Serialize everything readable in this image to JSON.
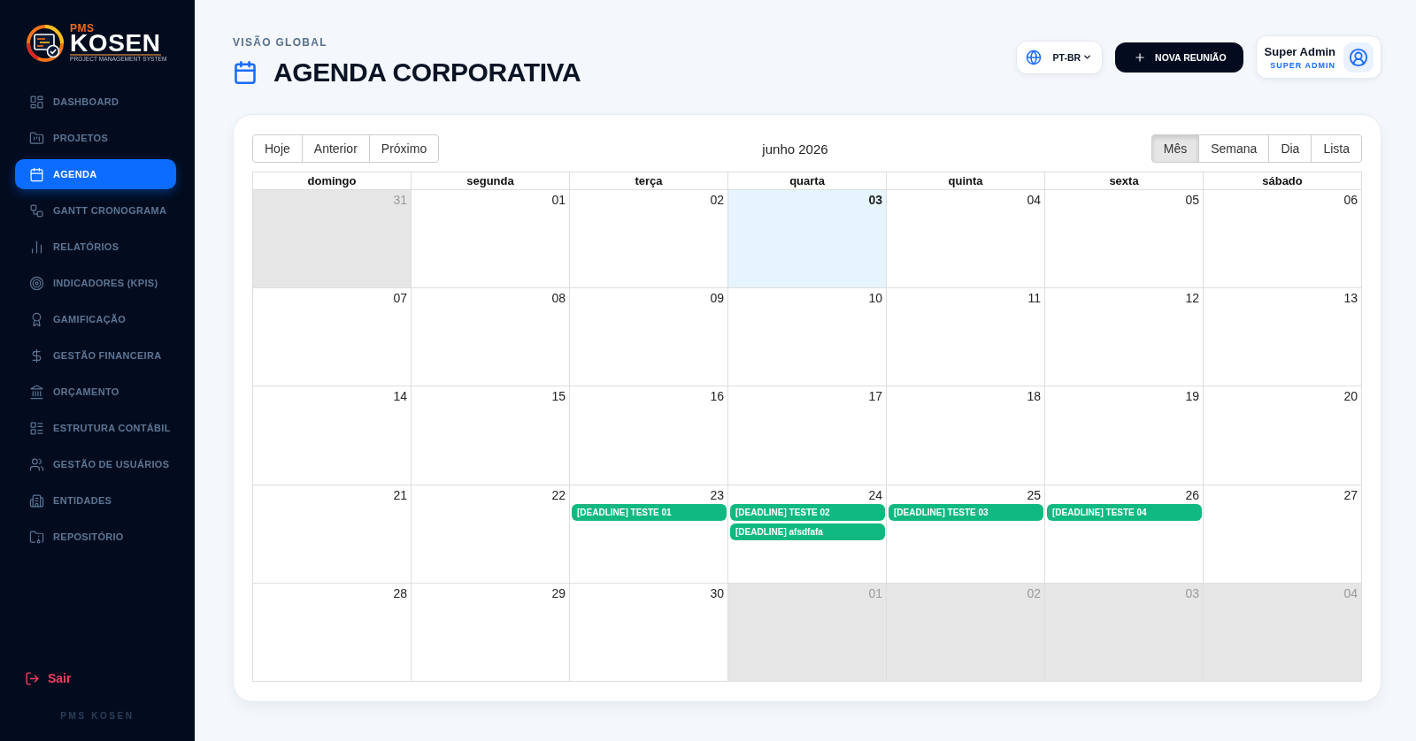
{
  "sidebar": {
    "logo": {
      "prefix": "PMS",
      "name": "KOSEN",
      "tagline": "PROJECT MANAGEMENT SYSTEM"
    },
    "items": [
      {
        "label": "DASHBOARD",
        "selected": false
      },
      {
        "label": "PROJETOS",
        "selected": false
      },
      {
        "label": "AGENDA",
        "selected": true
      },
      {
        "label": "GANTT CRONOGRAMA",
        "selected": false
      },
      {
        "label": "RELATÓRIOS",
        "selected": false
      },
      {
        "label": "INDICADORES (KPIS)",
        "selected": false
      },
      {
        "label": "GAMIFICAÇÃO",
        "selected": false
      },
      {
        "label": "GESTÃO FINANCEIRA",
        "selected": false
      },
      {
        "label": "ORÇAMENTO",
        "selected": false
      },
      {
        "label": "ESTRUTURA CONTÁBIL",
        "selected": false
      },
      {
        "label": "GESTÃO DE USUÁRIOS",
        "selected": false
      },
      {
        "label": "ENTIDADES",
        "selected": false
      },
      {
        "label": "REPOSITÓRIO",
        "selected": false
      }
    ],
    "logout": "Sair",
    "footer": "PMS KOSEN"
  },
  "header": {
    "eyebrow": "VISÃO GLOBAL",
    "title": "AGENDA CORPORATIVA",
    "language": "PT-BR",
    "primary_button": "NOVA REUNIÃO",
    "user": {
      "name": "Super Admin",
      "role": "SUPER ADMIN"
    }
  },
  "calendar": {
    "nav_buttons": [
      "Hoje",
      "Anterior",
      "Próximo"
    ],
    "title": "junho 2026",
    "views": [
      {
        "label": "Mês",
        "selected": true
      },
      {
        "label": "Semana",
        "selected": false
      },
      {
        "label": "Dia",
        "selected": false
      },
      {
        "label": "Lista",
        "selected": false
      }
    ],
    "weekdays": [
      "domingo",
      "segunda",
      "terça",
      "quarta",
      "quinta",
      "sexta",
      "sábado"
    ],
    "weeks": [
      {
        "days": [
          {
            "number": "31",
            "outside": true,
            "today": false
          },
          {
            "number": "01",
            "outside": false,
            "today": false
          },
          {
            "number": "02",
            "outside": false,
            "today": false
          },
          {
            "number": "03",
            "outside": false,
            "today": true
          },
          {
            "number": "04",
            "outside": false,
            "today": false
          },
          {
            "number": "05",
            "outside": false,
            "today": false
          },
          {
            "number": "06",
            "outside": false,
            "today": false
          }
        ]
      },
      {
        "days": [
          {
            "number": "07",
            "outside": false,
            "today": false
          },
          {
            "number": "08",
            "outside": false,
            "today": false
          },
          {
            "number": "09",
            "outside": false,
            "today": false
          },
          {
            "number": "10",
            "outside": false,
            "today": false
          },
          {
            "number": "11",
            "outside": false,
            "today": false
          },
          {
            "number": "12",
            "outside": false,
            "today": false
          },
          {
            "number": "13",
            "outside": false,
            "today": false
          }
        ]
      },
      {
        "days": [
          {
            "number": "14",
            "outside": false,
            "today": false
          },
          {
            "number": "15",
            "outside": false,
            "today": false
          },
          {
            "number": "16",
            "outside": false,
            "today": false
          },
          {
            "number": "17",
            "outside": false,
            "today": false
          },
          {
            "number": "18",
            "outside": false,
            "today": false
          },
          {
            "number": "19",
            "outside": false,
            "today": false
          },
          {
            "number": "20",
            "outside": false,
            "today": false
          }
        ]
      },
      {
        "days": [
          {
            "number": "21",
            "outside": false,
            "today": false
          },
          {
            "number": "22",
            "outside": false,
            "today": false
          },
          {
            "number": "23",
            "outside": false,
            "today": false,
            "events": [
              "[DEADLINE] TESTE 01"
            ]
          },
          {
            "number": "24",
            "outside": false,
            "today": false,
            "events": [
              "[DEADLINE] TESTE 02",
              "[DEADLINE] afsdfafa"
            ]
          },
          {
            "number": "25",
            "outside": false,
            "today": false,
            "events": [
              "[DEADLINE] TESTE 03"
            ]
          },
          {
            "number": "26",
            "outside": false,
            "today": false,
            "events": [
              "[DEADLINE] TESTE 04"
            ]
          },
          {
            "number": "27",
            "outside": false,
            "today": false
          }
        ]
      },
      {
        "days": [
          {
            "number": "28",
            "outside": false,
            "today": false
          },
          {
            "number": "29",
            "outside": false,
            "today": false
          },
          {
            "number": "30",
            "outside": false,
            "today": false
          },
          {
            "number": "01",
            "outside": true,
            "today": false
          },
          {
            "number": "02",
            "outside": true,
            "today": false
          },
          {
            "number": "03",
            "outside": true,
            "today": false
          },
          {
            "number": "04",
            "outside": true,
            "today": false
          }
        ]
      }
    ]
  }
}
